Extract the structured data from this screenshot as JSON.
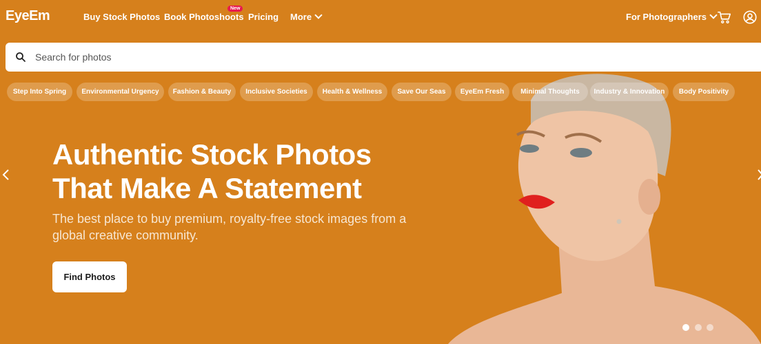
{
  "brand": {
    "logo": "EyeEm"
  },
  "nav": {
    "items": [
      {
        "label": "Buy Stock Photos"
      },
      {
        "label": "Book Photoshoots",
        "badge": "New"
      },
      {
        "label": "Pricing"
      },
      {
        "label": "More"
      }
    ],
    "right": {
      "photographers": "For Photographers"
    }
  },
  "search": {
    "placeholder": "Search for photos",
    "value": ""
  },
  "categories": [
    "Step Into Spring",
    "Environmental Urgency",
    "Fashion & Beauty",
    "Inclusive Societies",
    "Health & Wellness",
    "Save Our Seas",
    "EyeEm Fresh",
    "Minimal Thoughts",
    "Industry & Innovation",
    "Body Positivity"
  ],
  "hero": {
    "title_line1": "Authentic Stock Photos",
    "title_line2": "That Make A Statement",
    "subtitle": "The best place to buy premium, royalty-free stock images from a global creative community.",
    "cta": "Find Photos"
  },
  "carousel": {
    "slides": 3,
    "active": 1
  },
  "colors": {
    "background": "#d6801c",
    "badge": "#e8194f",
    "button_bg": "#ffffff"
  },
  "icons": [
    "search-icon",
    "cart-icon",
    "user-icon",
    "chevron-down-icon",
    "chevron-left-icon",
    "chevron-right-icon"
  ]
}
